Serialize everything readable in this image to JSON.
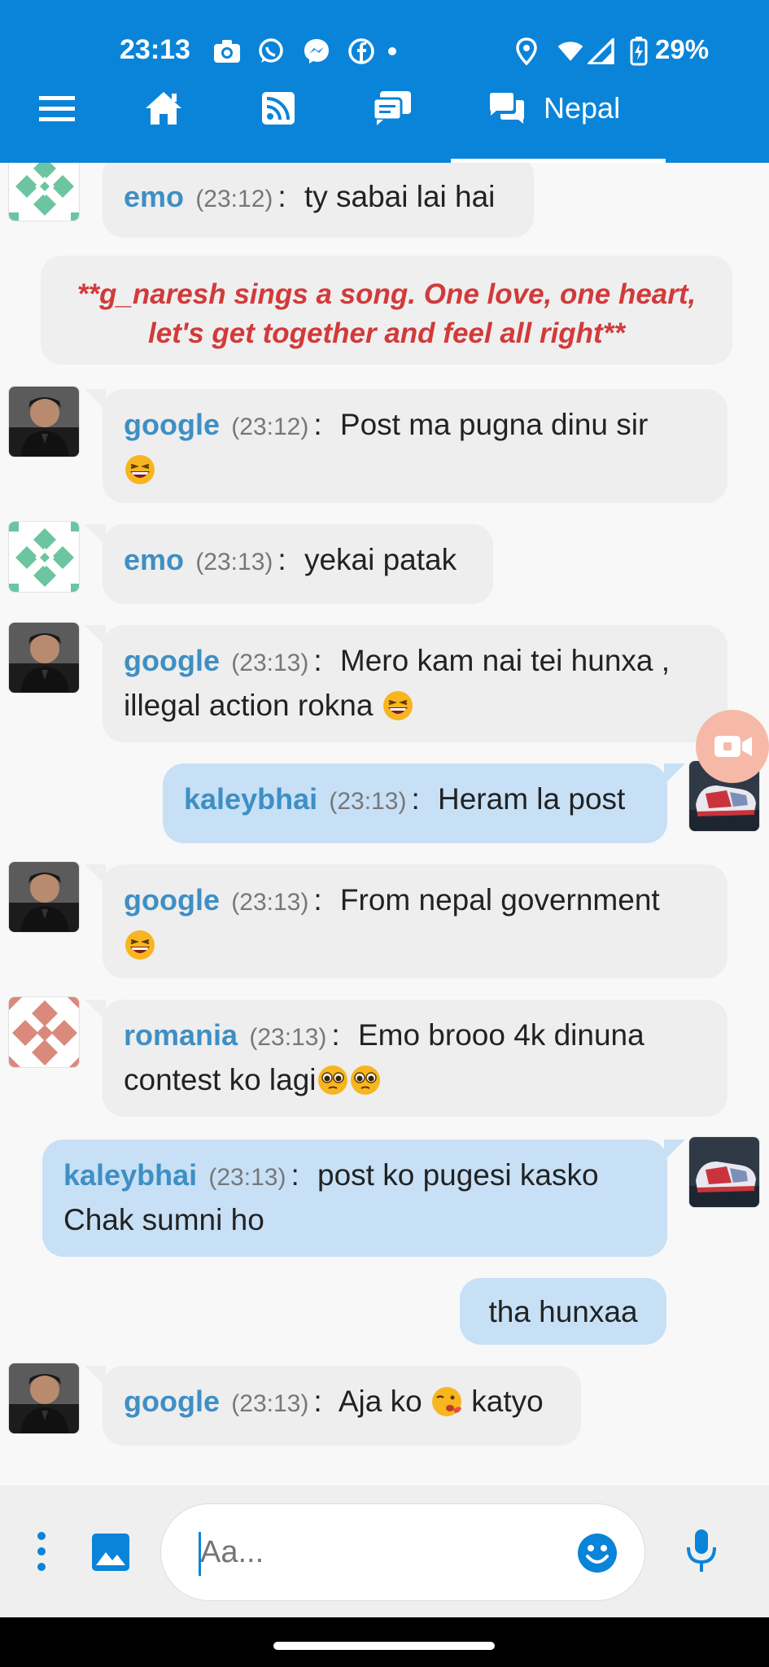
{
  "status_bar": {
    "time": "23:13",
    "icons": [
      "camera-icon",
      "whatsapp-icon",
      "messenger-icon",
      "facebook-icon",
      "dot-icon",
      "location-icon",
      "wifi-icon",
      "signal-icon",
      "battery-charging-icon"
    ],
    "battery": "29%"
  },
  "nav": {
    "active_tab_label": "Nepal",
    "colors": {
      "header": "#0a84d9",
      "link": "#3e8fc4",
      "action_text": "#d23a3a",
      "outgoing_bubble": "#c7e0f6",
      "incoming_bubble": "#eeeeee"
    }
  },
  "messages": [
    {
      "user": "emo",
      "time": "(23:12)",
      "sep": ":",
      "text": "ty sabai lai hai"
    },
    {
      "action": "**g_naresh sings a song. One love, one heart, let's get together and feel all right**"
    },
    {
      "user": "google",
      "time": "(23:12)",
      "sep": ":",
      "text": "Post ma pugna dinu sir"
    },
    {
      "user": "emo",
      "time": "(23:13)",
      "sep": ":",
      "text": "yekai patak"
    },
    {
      "user": "google",
      "time": "(23:13)",
      "sep": ":",
      "text": "Mero kam nai tei hunxa ,",
      "text2": "illegal action rokna"
    },
    {
      "user": "kaleybhai",
      "time": "(23:13)",
      "sep": ":",
      "text": "Heram la post"
    },
    {
      "user": "google",
      "time": "(23:13)",
      "sep": ":",
      "text": "From nepal government"
    },
    {
      "user": "romania",
      "time": "(23:13)",
      "sep": ":",
      "text": "Emo brooo 4k dinuna",
      "text2": "contest ko lagi"
    },
    {
      "user": "kaleybhai",
      "time": "(23:13)",
      "sep": ":",
      "text": "post ko pugesi kasko",
      "text2": "Chak sumni ho"
    },
    {
      "text": "tha hunxaa"
    },
    {
      "user": "google",
      "time": "(23:13)",
      "sep": ":",
      "text": "Aja ko",
      "text2": "katyo"
    }
  ],
  "composer": {
    "placeholder": "Aa..."
  }
}
